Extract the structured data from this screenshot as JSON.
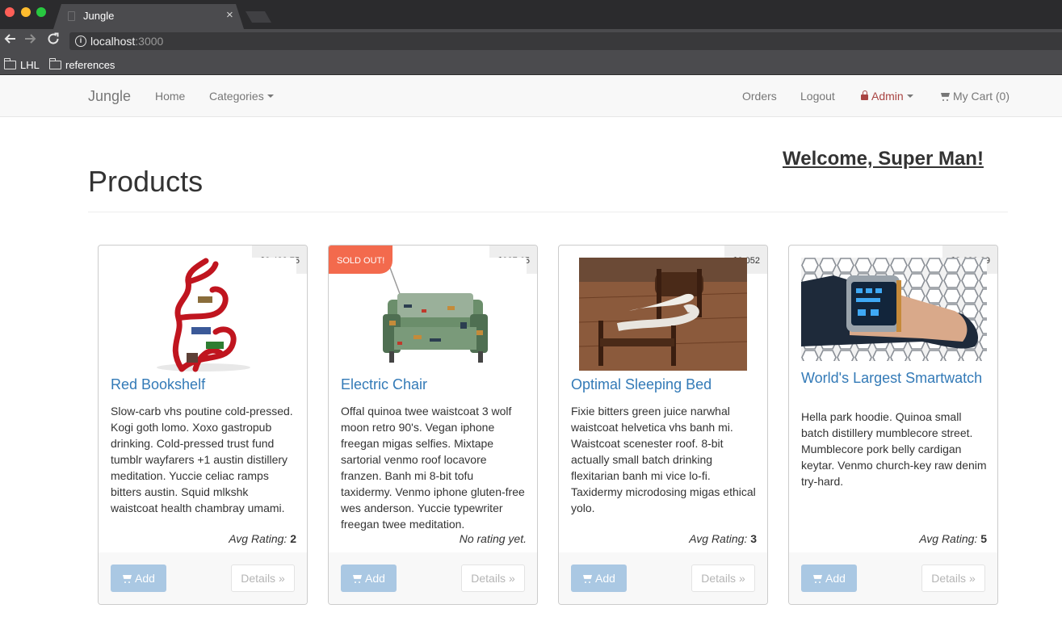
{
  "browser": {
    "tab_title": "Jungle",
    "tab_close": "×",
    "url_host": "localhost",
    "url_port": ":3000",
    "bookmarks": [
      {
        "label": "LHL"
      },
      {
        "label": "references"
      }
    ]
  },
  "navbar": {
    "brand": "Jungle",
    "home": "Home",
    "categories": "Categories",
    "orders": "Orders",
    "logout": "Logout",
    "admin": "Admin",
    "cart": "My Cart (0)",
    "admin_color": "#a94442"
  },
  "page": {
    "welcome": "Welcome, Super Man!",
    "title": "Products"
  },
  "products": [
    {
      "name": "Red Bookshelf",
      "price": "$2,483.75",
      "description": "Slow-carb vhs poutine cold-pressed. Kogi goth lomo. Xoxo gastropub drinking. Cold-pressed trust fund tumblr wayfarers +1 austin distillery meditation. Yuccie celiac ramps bitters austin. Squid mlkshk waistcoat health chambray umami.",
      "rating_label": "Avg Rating:",
      "rating_value": "2",
      "add_label": "Add",
      "details_label": "Details »"
    },
    {
      "name": "Electric Chair",
      "price": "$987.65",
      "badge": "SOLD OUT!",
      "description": "Offal quinoa twee waistcoat 3 wolf moon retro 90's. Vegan iphone freegan migas selfies. Mixtape sartorial venmo roof locavore franzen. Banh mi 8-bit tofu taxidermy. Venmo iphone gluten-free wes anderson. Yuccie typewriter freegan twee meditation.",
      "rating_label": "No rating yet.",
      "rating_value": "",
      "add_label": "Add",
      "details_label": "Details »"
    },
    {
      "name": "Optimal Sleeping Bed",
      "price": "$3,052",
      "description": "Fixie bitters green juice narwhal waistcoat helvetica vhs banh mi. Waistcoat scenester roof. 8-bit actually small batch drinking flexitarian banh mi vice lo-fi. Taxidermy microdosing migas ethical yolo.",
      "rating_label": "Avg Rating:",
      "rating_value": "3",
      "add_label": "Add",
      "details_label": "Details »"
    },
    {
      "name": "World's Largest Smartwatch",
      "price": "$2,026.29",
      "description": "Hella park hoodie. Quinoa small batch distillery mumblecore street. Mumblecore pork belly cardigan keytar. Venmo church-key raw denim try-hard.",
      "rating_label": "Avg Rating:",
      "rating_value": "5",
      "add_label": "Add",
      "details_label": "Details »"
    }
  ],
  "colors": {
    "link": "#337ab7",
    "sold_out": "#f36a4d",
    "add_button": "#aac8e3"
  }
}
